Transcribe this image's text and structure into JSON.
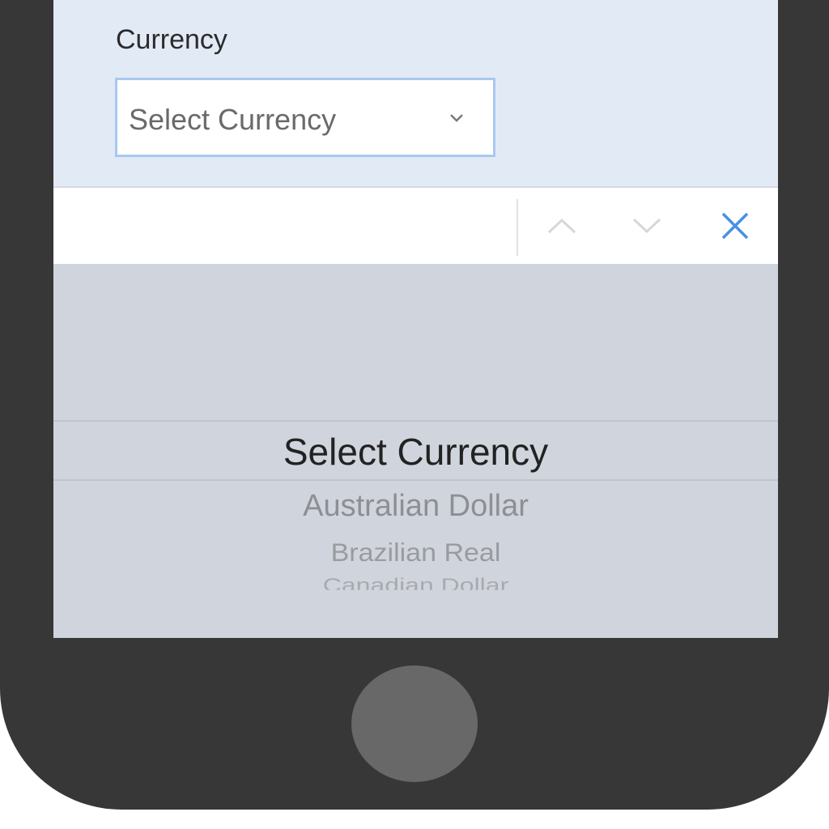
{
  "form": {
    "currency_label": "Currency",
    "select": {
      "value": "Select Currency",
      "icon": "chevron-down-icon"
    }
  },
  "toolbar": {
    "prev_icon": "chevron-up-icon",
    "next_icon": "chevron-down-icon",
    "close_icon": "close-icon",
    "accent_color": "#4a90e2"
  },
  "picker": {
    "selected": "Select Currency",
    "options": [
      "Australian Dollar",
      "Brazilian Real",
      "Canadian Dollar"
    ]
  },
  "device": {
    "home_button_icon": "home-button"
  }
}
